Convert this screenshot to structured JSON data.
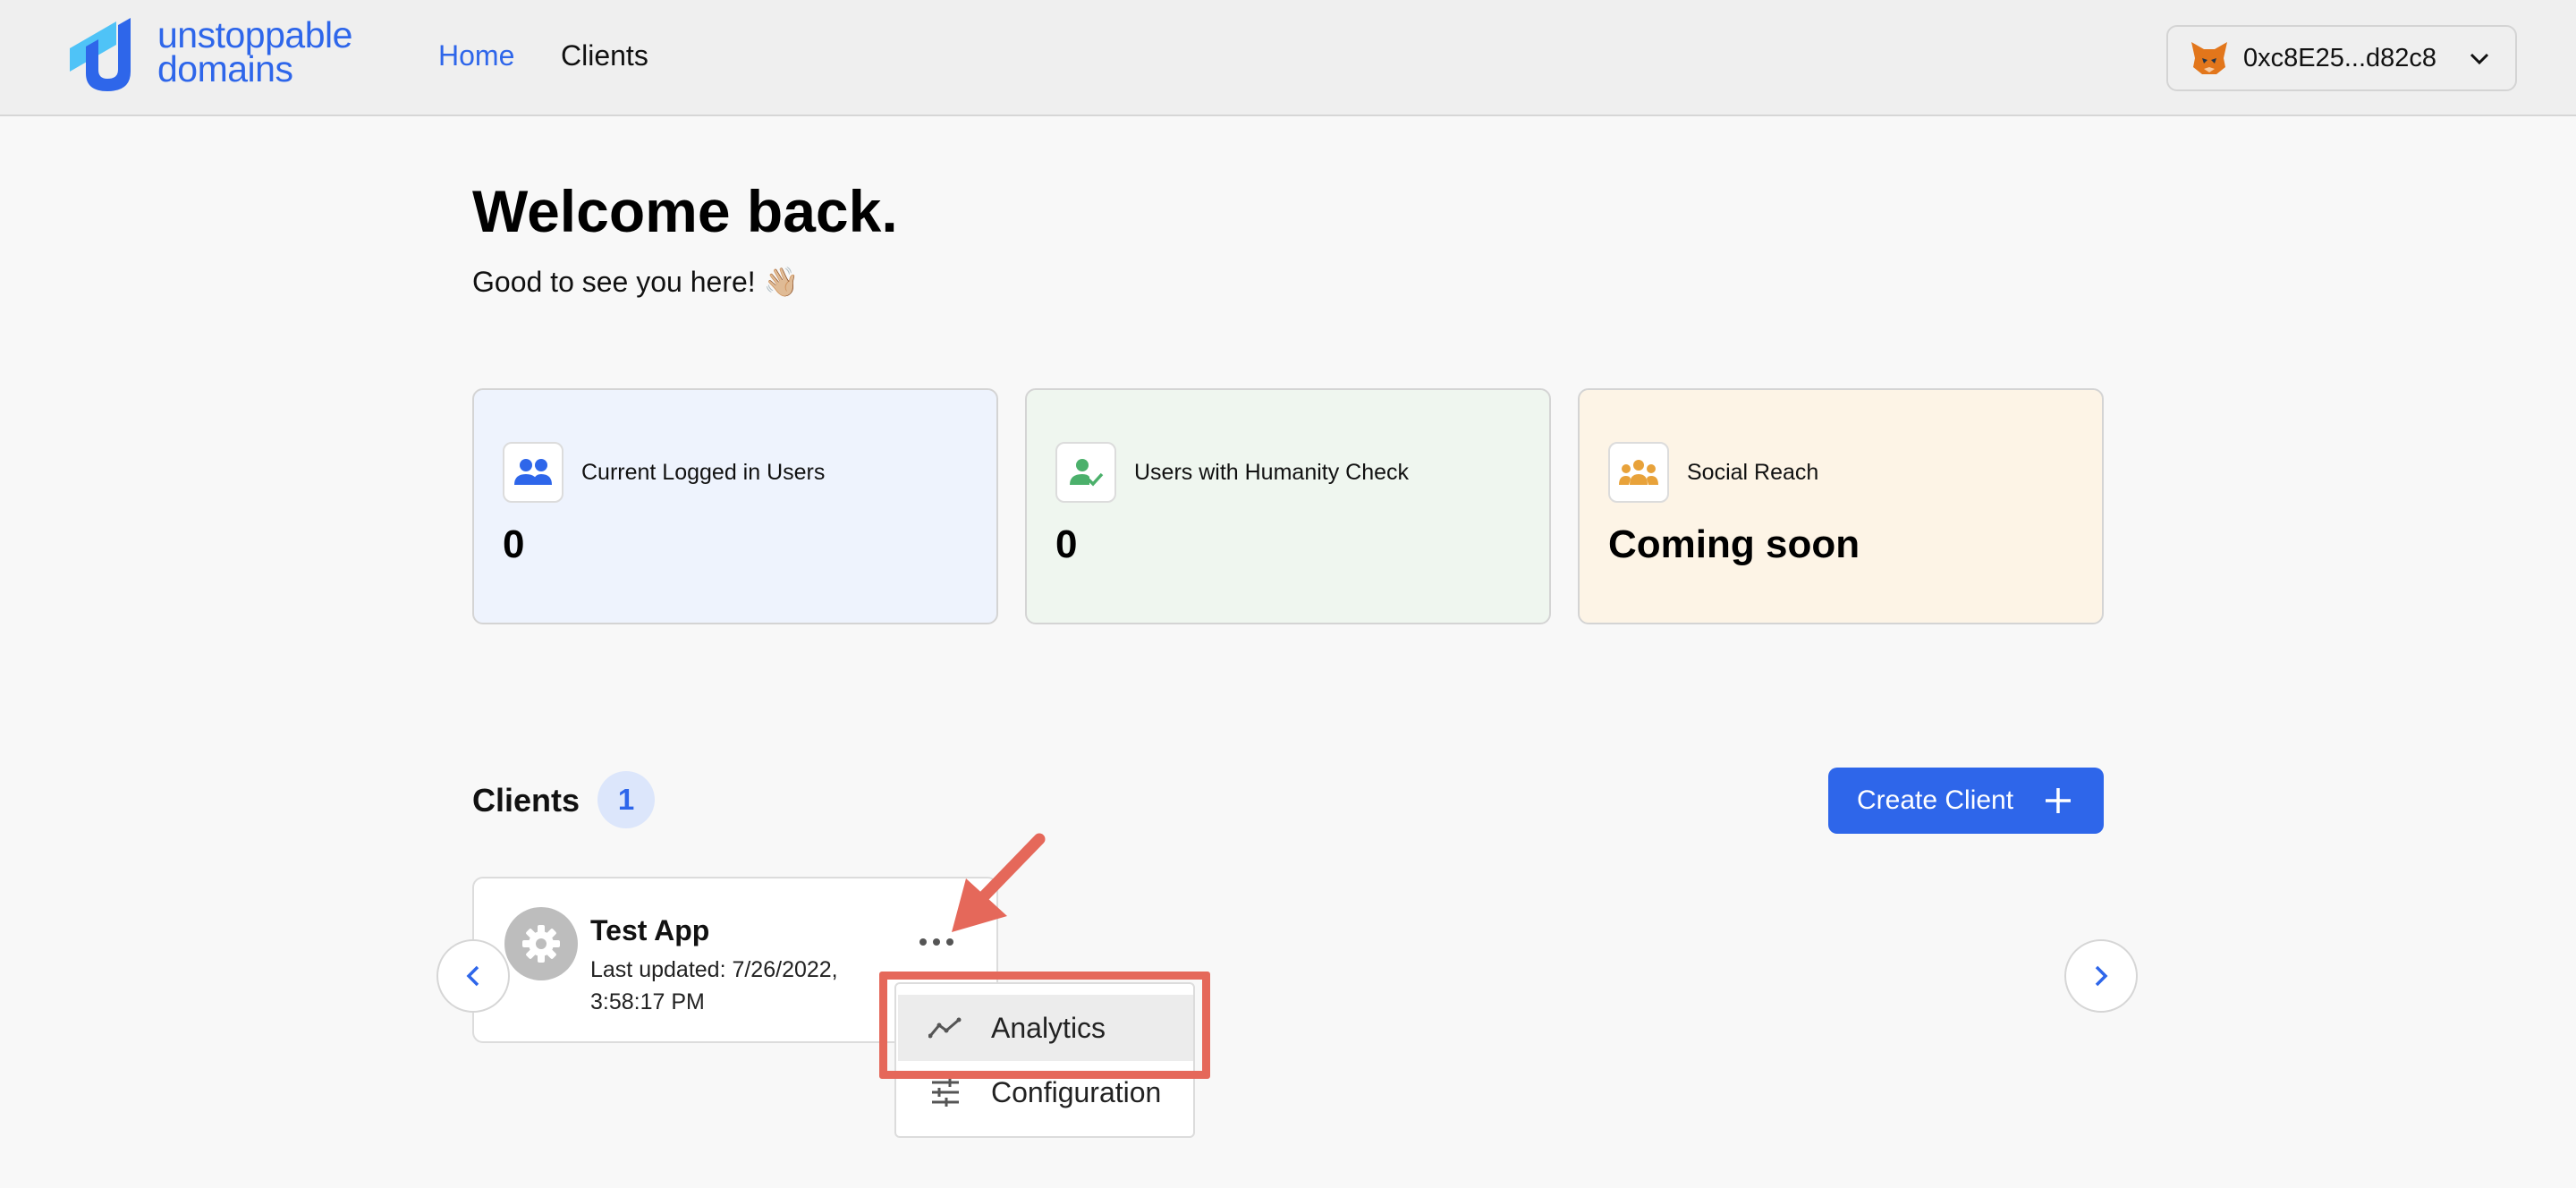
{
  "brand": {
    "line1": "unstoppable",
    "line2": "domains",
    "color": "#2e66ea"
  },
  "nav": {
    "home": "Home",
    "clients": "Clients"
  },
  "wallet": {
    "address": "0xc8E25...d82c8",
    "icon": "metamask-fox-icon"
  },
  "welcome": {
    "title": "Welcome back.",
    "subtitle": "Good to see you here! 👋🏼"
  },
  "stats": [
    {
      "label": "Current Logged in Users",
      "value": "0",
      "icon": "users-icon",
      "icon_color": "#2e66ea",
      "background": "#eef3fd"
    },
    {
      "label": "Users with Humanity Check",
      "value": "0",
      "icon": "user-check-icon",
      "icon_color": "#4bb06b",
      "background": "#eff6ef"
    },
    {
      "label": "Social Reach",
      "value": "Coming soon",
      "icon": "group-icon",
      "icon_color": "#e8a23a",
      "background": "#fdf4e6"
    }
  ],
  "clients": {
    "title": "Clients",
    "count": "1",
    "create_label": "Create Client",
    "items": [
      {
        "name": "Test App",
        "updated": "Last updated: 7/26/2022, 3:58:17 PM"
      }
    ]
  },
  "menu": {
    "items": [
      "Analytics",
      "Configuration"
    ]
  },
  "annotation": {
    "color": "#e5685a",
    "highlighted": "Analytics"
  }
}
